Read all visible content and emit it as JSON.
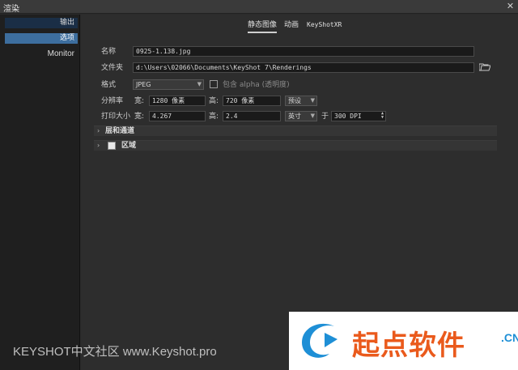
{
  "window": {
    "title": "渲染",
    "close_glyph": "✕"
  },
  "sidebar": {
    "items": [
      {
        "label": "输出"
      },
      {
        "label": "选项"
      },
      {
        "label": "Monitor"
      }
    ]
  },
  "tabs": [
    {
      "label": "静态图像"
    },
    {
      "label": "动画"
    },
    {
      "label": "KeyShotXR"
    }
  ],
  "form": {
    "name_label": "名称",
    "name_value": "0925-1.138.jpg",
    "folder_label": "文件夹",
    "folder_value": "d:\\Users\\02066\\Documents\\KeyShot 7\\Renderings",
    "format_label": "格式",
    "format_value": "JPEG",
    "alpha_label": "包含 alpha (透明度)",
    "resolution_label": "分辨率",
    "width_label": "宽:",
    "height_label": "高:",
    "res_width_value": "1280 像素",
    "res_height_value": "720 像素",
    "preset_value": "预设",
    "print_label": "打印大小",
    "print_width_value": "4.267",
    "print_height_value": "2.4",
    "unit_value": "英寸",
    "at_label": "于",
    "dpi_value": "300 DPI"
  },
  "sections": {
    "layers_label": "层和通道",
    "region_label": "区域"
  },
  "watermark": {
    "text": "KEYSHOT中文社区 www.Keyshot.pro"
  },
  "logo": {
    "text": "起点软件",
    "suffix": ".CN"
  },
  "colors": {
    "accent": "#3d6e9e",
    "export_bg": "#1a2e46",
    "logo_orange": "#ea5a1c",
    "logo_blue": "#1e8fd6"
  }
}
